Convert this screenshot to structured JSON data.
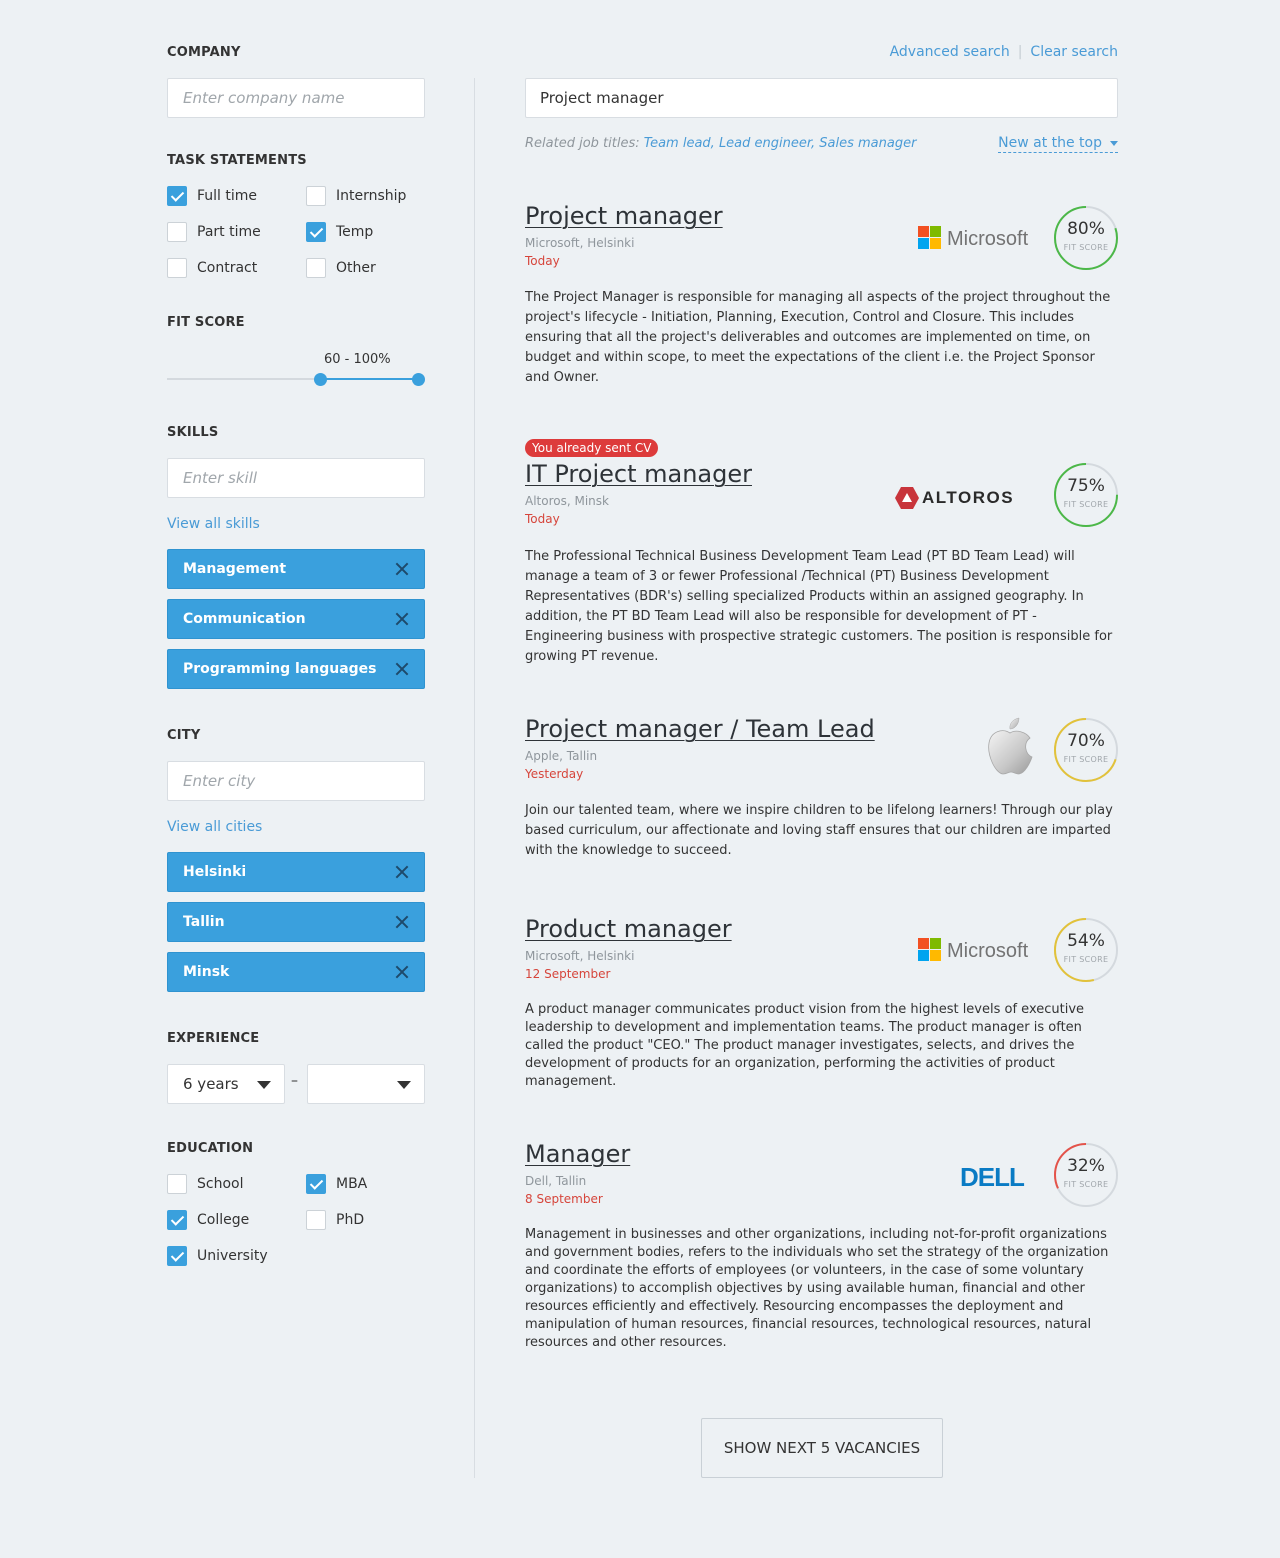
{
  "filters": {
    "company": {
      "title": "COMPANY",
      "placeholder": "Enter company name",
      "value": ""
    },
    "task_statements": {
      "title": "TASK STATEMENTS",
      "options": [
        {
          "label": "Full time",
          "checked": true
        },
        {
          "label": "Internship",
          "checked": false
        },
        {
          "label": "Part time",
          "checked": false
        },
        {
          "label": "Temp",
          "checked": true
        },
        {
          "label": "Contract",
          "checked": false
        },
        {
          "label": "Other",
          "checked": false
        }
      ]
    },
    "fit_score": {
      "title": "FIT SCORE",
      "range_label": "60 - 100%",
      "min": 60,
      "max": 100
    },
    "skills": {
      "title": "SKILLS",
      "placeholder": "Enter skill",
      "view_all": "View all skills",
      "tags": [
        "Management",
        "Communication",
        "Programming languages"
      ]
    },
    "city": {
      "title": "CITY",
      "placeholder": "Enter city",
      "view_all": "View all cities",
      "tags": [
        "Helsinki",
        "Tallin",
        "Minsk"
      ]
    },
    "experience": {
      "title": "EXPERIENCE",
      "from": "6 years",
      "to": "",
      "separator": "–"
    },
    "education": {
      "title": "EDUCATION",
      "options": [
        {
          "label": "School",
          "checked": false
        },
        {
          "label": "MBA",
          "checked": true
        },
        {
          "label": "College",
          "checked": true
        },
        {
          "label": "PhD",
          "checked": false
        },
        {
          "label": "University",
          "checked": true
        }
      ]
    }
  },
  "search": {
    "advanced_label": "Advanced search",
    "clear_label": "Clear search",
    "query": "Project manager",
    "related_prefix": "Related job titles:",
    "related_titles": "Team lead, Lead engineer, Sales manager",
    "sort_label": "New at the top"
  },
  "jobs": [
    {
      "title": "Project manager",
      "company": "Microsoft, Helsinki",
      "date": "Today",
      "logo": "Microsoft",
      "fit": 80,
      "fit_text": "80%",
      "fit_label": "FIT SCORE",
      "fit_color": "#4cb848",
      "description": "The Project Manager is responsible for managing all aspects of the project throughout the project's lifecycle - Initiation, Planning, Execution, Control and Closure. This includes ensuring that all the project's deliverables and outcomes are implemented on time, on budget and within scope, to meet the expectations of the client i.e. the Project Sponsor and Owner."
    },
    {
      "badge": "You already sent CV",
      "title": "IT Project manager",
      "company": "Altoros, Minsk",
      "date": "Today",
      "logo": "ALTOROS",
      "fit": 75,
      "fit_text": "75%",
      "fit_label": "FIT SCORE",
      "fit_color": "#4cb848",
      "description": "The Professional Technical Business Development Team Lead (PT BD Team Lead) will manage a team of 3 or fewer Professional /Technical (PT) Business Development Representatives (BDR's) selling specialized Products within an assigned geography. In addition, the PT BD Team Lead will also be responsible for development of PT - Engineering business with prospective strategic customers. The position is responsible for growing PT revenue."
    },
    {
      "title": "Project manager / Team Lead",
      "company": "Apple, Tallin",
      "date": "Yesterday",
      "logo": "apple-logo-icon",
      "fit": 70,
      "fit_text": "70%",
      "fit_label": "FIT SCORE",
      "fit_color": "#e2c23a",
      "description": "Join our talented team, where we inspire children to be lifelong learners! Through our play based curriculum, our affectionate and loving staff ensures that our children are imparted with the knowledge to succeed."
    },
    {
      "title": "Product manager",
      "company": "Microsoft, Helsinki",
      "date": "12 September",
      "logo": "Microsoft",
      "fit": 54,
      "fit_text": "54%",
      "fit_label": "FIT SCORE",
      "fit_color": "#e2c23a",
      "description": "A product manager communicates product vision from the highest levels of executive leadership to development and implementation teams. The product manager is often called the product \"CEO.\" The product manager investigates, selects, and drives the development of products for an organization, performing the activities of product management."
    },
    {
      "title": "Manager",
      "company": "Dell, Tallin",
      "date": "8 September",
      "logo": "DELL",
      "fit": 32,
      "fit_text": "32%",
      "fit_label": "FIT SCORE",
      "fit_color": "#e4534a",
      "description": "Management in businesses and other organizations, including not-for-profit organizations and government bodies, refers to the individuals who set the strategy of the organization and coordinate the efforts of employees (or volunteers, in the case of some voluntary organizations) to accomplish objectives by using available human, financial and other resources efficiently and effectively. Resourcing encompasses the deployment and manipulation of human resources, financial resources, technological resources, natural resources and other resources."
    }
  ],
  "show_more_label": "SHOW NEXT 5 VACANCIES",
  "colors": {
    "accent": "#3aa0dd",
    "link": "#4a9bd6",
    "date": "#d6453b",
    "badge": "#dd3b3b"
  }
}
